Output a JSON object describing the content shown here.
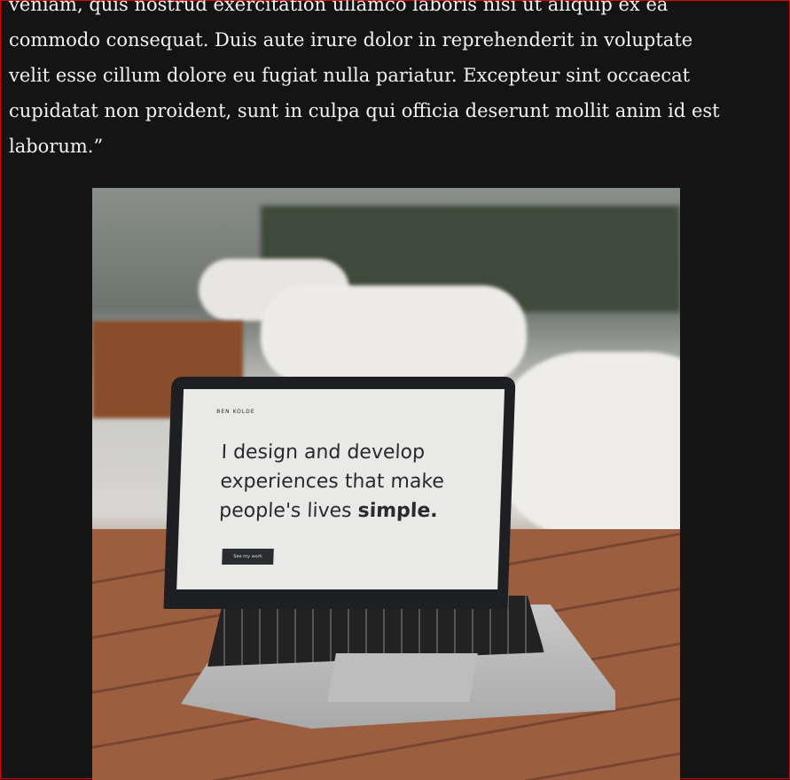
{
  "article": {
    "lines": [
      "veniam, quis nostrud exercitation ullamco laboris nisi ut aliquip ex ea",
      "commodo consequat. Duis aute irure dolor in reprehenderit in voluptate",
      "velit esse cillum dolore eu fugiat nulla pariatur. Excepteur sint occaecat",
      "cupidatat non proident, sunt in culpa qui officia deserunt mollit anim id est",
      "laborum.”"
    ]
  },
  "photo": {
    "screen_brand": "BEN KOLDE",
    "headline_1": "I design and develop",
    "headline_2": "experiences that make",
    "headline_3": "people's lives ",
    "headline_bold": "simple.",
    "cta": "See my work"
  }
}
